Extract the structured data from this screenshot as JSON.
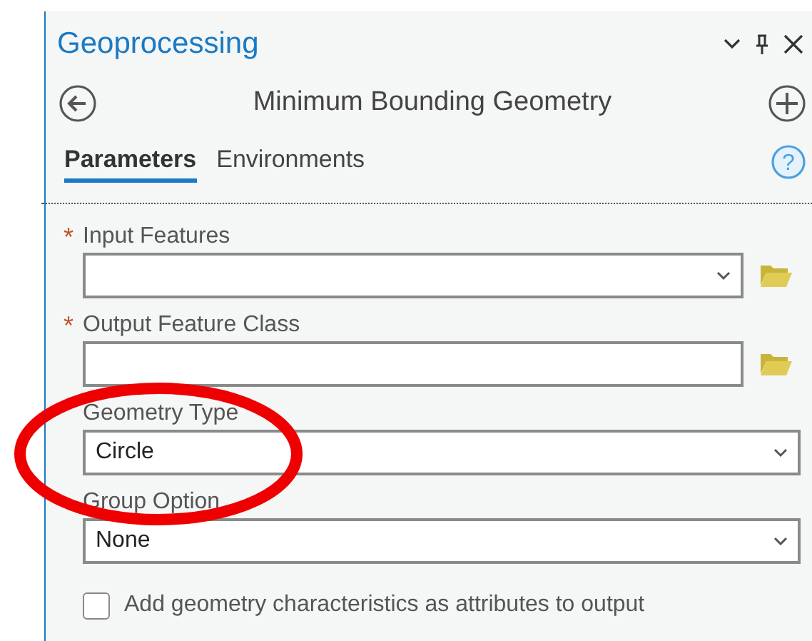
{
  "pane": {
    "title": "Geoprocessing"
  },
  "tool": {
    "title": "Minimum Bounding Geometry"
  },
  "tabs": [
    {
      "label": "Parameters",
      "selected": true
    },
    {
      "label": "Environments",
      "selected": false
    }
  ],
  "help": {
    "glyph": "?"
  },
  "parameters": [
    {
      "kind": "dropdown",
      "marker": "*",
      "label": "Input Features",
      "browse": true
    },
    {
      "kind": "text",
      "marker": "*",
      "label": "Output Feature Class",
      "browse": true
    },
    {
      "kind": "dropdown",
      "label": "Geometry Type",
      "value": "Circle",
      "browse": false
    },
    {
      "kind": "dropdown",
      "label": "Group Option",
      "value": "None",
      "browse": false
    },
    {
      "kind": "checkbox",
      "label": "Add geometry characteristics as attributes to output",
      "checked": false
    }
  ]
}
